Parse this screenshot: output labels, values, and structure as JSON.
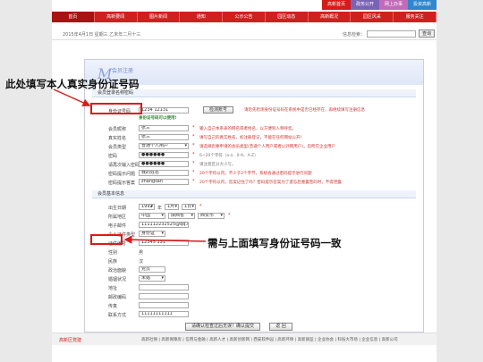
{
  "toplinks": [
    "高新首页",
    "政务公开",
    "网上办事",
    "投资高新"
  ],
  "nav": [
    "首页",
    "高新要闻",
    "图片新闻",
    "通知",
    "公示公告",
    "园区动态",
    "高新概况",
    "园区风采",
    "服务关注"
  ],
  "datebar": {
    "date": "2015年4月1日  星期三  乙未年二月十三",
    "search_label": "信息检索：",
    "search_button": "查询"
  },
  "banner": {
    "logo": "M",
    "title": "会员注册"
  },
  "sections": {
    "login_info": "会员登录名称密码",
    "basic_info": "会员基本信息"
  },
  "form": {
    "id_number": {
      "label": "身份证号码",
      "value": "1234                12131",
      "check_button": "检测账号",
      "ok_text": "身份证号码可以使用!",
      "note": "请您先检测身份证号码在系统中是否已经存在，再继续填写注册信息"
    },
    "member_name": {
      "label": "会员昵称",
      "value": "张三",
      "note": "输入自己本系表的网名或者姓名，以方便别人称呼您。"
    },
    "real_name": {
      "label": "真实姓名",
      "value": "张三",
      "note": "填写自己的真实姓名，如注册登记，不能在任何网站公开！"
    },
    "member_type": {
      "label": "会员类型",
      "value": "普通个人用户",
      "note": "请选择您要申请的会员类型(普通个人用户或者以外网用户)，您所在企业用户"
    },
    "password": {
      "label": "密码",
      "value": "●●●●●●",
      "note": "6~20个字符（a-z、0-9、A-Z）"
    },
    "confirm_password": {
      "label": "请再次输入密码",
      "value": "●●●●●●",
      "note": "请注意区分大小写。"
    },
    "secret_question": {
      "label": "密码提示问题",
      "value": "我的姓名",
      "note": "20个字符以内，不少于2个字节，系统会通过密码提示进行问题"
    },
    "secret_answer": {
      "label": "密码提示答案",
      "value": "zhangsan",
      "note": "20个字符以内，答案记住了吗？密码提示答案为了遗忘后重置密码时，不得泄露"
    },
    "birth": {
      "label": "出生日期",
      "year": "1992",
      "year_unit": "年",
      "month": "1月",
      "day": "1日"
    },
    "region": {
      "label": "所属地区",
      "country": "中国",
      "province": "陕西省",
      "city": "西安市"
    },
    "email": {
      "label": "电子邮件",
      "value": "111112232525@qq.com"
    },
    "id_type": {
      "label": "个人证件类型",
      "value": "身份证"
    },
    "id_number_2": {
      "label": "证件编号",
      "value": "12345                    131"
    },
    "gender": {
      "label": "性别",
      "value": "男"
    },
    "ethnicity": {
      "label": "民族",
      "value": "汉"
    },
    "political": {
      "label": "政治面貌",
      "value": "党员"
    },
    "marriage": {
      "label": "婚姻状况",
      "value": "未婚"
    },
    "address": {
      "label": "地址",
      "value": ""
    },
    "postcode": {
      "label": "邮政编码",
      "value": ""
    },
    "qq": {
      "label": "传真",
      "value": ""
    },
    "phone": {
      "label": "联系方式",
      "value": "11111111111"
    },
    "submit_button": "请确认检查过后无误！确认提交",
    "reset_button": "返 回"
  },
  "annotations": {
    "top": "此处填写本人真实身份证号码",
    "bottom": "需与上面填写身份证号码一致"
  },
  "footer": {
    "logo": "高新区党建",
    "links": "高新社保 | 高新保障房 | 信用与金融 | 高新人才 | 高新创新网 | 西安软件园 | 高新环保 | 高新质监 | 企业协会 | 科技大市场 | 企业信息 | 高新公司"
  },
  "colors": {
    "nav_red": "#cf2020",
    "note_red": "#cc3333",
    "annotation_red": "#e01818"
  }
}
